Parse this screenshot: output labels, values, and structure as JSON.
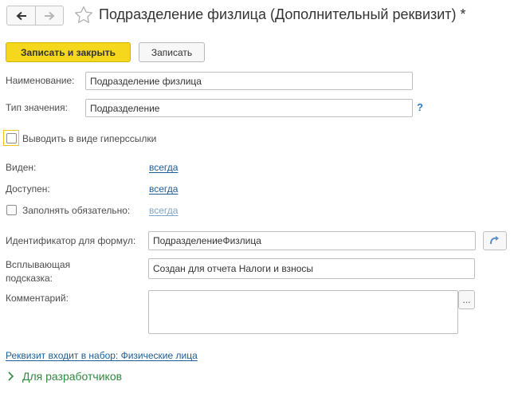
{
  "header": {
    "title": "Подразделение физлица (Дополнительный реквизит) *",
    "back_icon": "arrow-left-icon",
    "forward_icon": "arrow-right-icon",
    "favorite_icon": "star-outline-icon"
  },
  "toolbar": {
    "save_close_label": "Записать и закрыть",
    "save_label": "Записать"
  },
  "form": {
    "name_label": "Наименование:",
    "name_value": "Подразделение физлица",
    "type_label": "Тип значения:",
    "type_value": "Подразделение",
    "help_glyph": "?",
    "hyperlink_checkbox_label": "Выводить в виде гиперссылки",
    "visible_label": "Виден:",
    "visible_value": "всегда",
    "available_label": "Доступен:",
    "available_value": "всегда",
    "required_checkbox_label": "Заполнять обязательно:",
    "required_value": "всегда",
    "formula_id_label": "Идентификатор для формул:",
    "formula_id_value": "ПодразделениеФизлица",
    "tooltip_label_line1": "Всплывающая",
    "tooltip_label_line2": "подсказка:",
    "tooltip_value": "Создан для отчета Налоги и взносы",
    "comment_label": "Комментарий:",
    "comment_value": "",
    "comment_button": "...",
    "set_link": "Реквизит входит в набор: Физические лица",
    "developers_label": "Для разработчиков"
  },
  "colors": {
    "accent": "#f5d71d",
    "link": "#1d5e96",
    "group_header": "#2e8b3e"
  }
}
